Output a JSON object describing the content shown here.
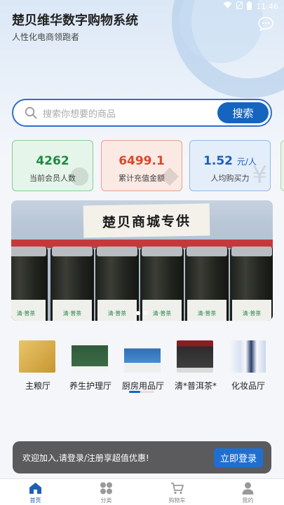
{
  "status_bar": {
    "time": "11:46"
  },
  "header": {
    "title": "楚贝维华数字购物系统",
    "subtitle": "人性化电商领跑者"
  },
  "search": {
    "placeholder": "搜索你想要的商品",
    "button_label": "搜索"
  },
  "stats": [
    {
      "value": "4262",
      "label": "当前会员人数"
    },
    {
      "value": "6499.1",
      "label": "累计充值金额"
    },
    {
      "value": "1.52",
      "unit": "元/人",
      "label": "人均购买力"
    }
  ],
  "banner": {
    "sign_text": "楚贝商城专供",
    "jar_label": "清·普茶",
    "slide_count": 2,
    "active_slide": 1
  },
  "categories": [
    {
      "label": "主粮厅"
    },
    {
      "label": "养生护理厅"
    },
    {
      "label": "厨房用品厅"
    },
    {
      "label": "清*普洱茶*"
    },
    {
      "label": "化妆品厅"
    }
  ],
  "login_prompt": {
    "message": "欢迎加入,请登录/注册享超值优惠!",
    "button_label": "立即登录"
  },
  "tabbar": [
    {
      "label": "首页",
      "icon": "home-icon",
      "active": true
    },
    {
      "label": "分类",
      "icon": "category-icon",
      "active": false
    },
    {
      "label": "购物车",
      "icon": "cart-icon",
      "active": false
    },
    {
      "label": "我的",
      "icon": "user-icon",
      "active": false
    }
  ],
  "colors": {
    "primary": "#1565c0",
    "stat_green": "#1f8a40",
    "stat_red": "#d84a2a",
    "stat_blue": "#1f5fb7",
    "toast_bg": "#5b5b5e"
  }
}
